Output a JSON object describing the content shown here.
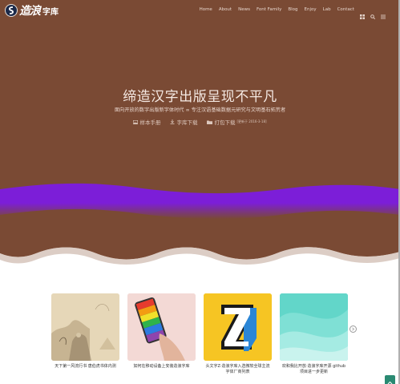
{
  "logo": {
    "brush_text": "造浪",
    "suffix": "字库"
  },
  "nav": {
    "items": [
      "Home",
      "About",
      "News",
      "Font Family",
      "Blog",
      "Enjoy",
      "Lab",
      "Contact"
    ]
  },
  "hero": {
    "title": "缔造汉字出版呈现不平凡",
    "subtitle": "面向开放的数字出版新字体时代 ∞ 专注汉语基础数据元研究与文明基石拓荒者",
    "links": [
      {
        "label": "样本手册",
        "icon": "image-icon"
      },
      {
        "label": "字库下载",
        "icon": "download-icon"
      },
      {
        "label": "打包下载",
        "icon": "folder-icon"
      }
    ],
    "note": "[更新于 2016-3-18]"
  },
  "cards": [
    {
      "caption": "天下第一风流行书 唐伯虎书体内测",
      "art": "painting"
    },
    {
      "caption": "如何在移动设备上安装造浪字库",
      "art": "phone"
    },
    {
      "caption": "头文字Z·造浪字库入选微软全球主流字体厂商列表",
      "art": "z-logo"
    },
    {
      "caption": "欢和我比开放·造浪字库开源 github 项目进一步更新",
      "art": "teal-waves"
    }
  ],
  "colors": {
    "hero_bg": "#7a4a34",
    "stripe": "#7c1ed8",
    "accent": "#2a8a72"
  }
}
